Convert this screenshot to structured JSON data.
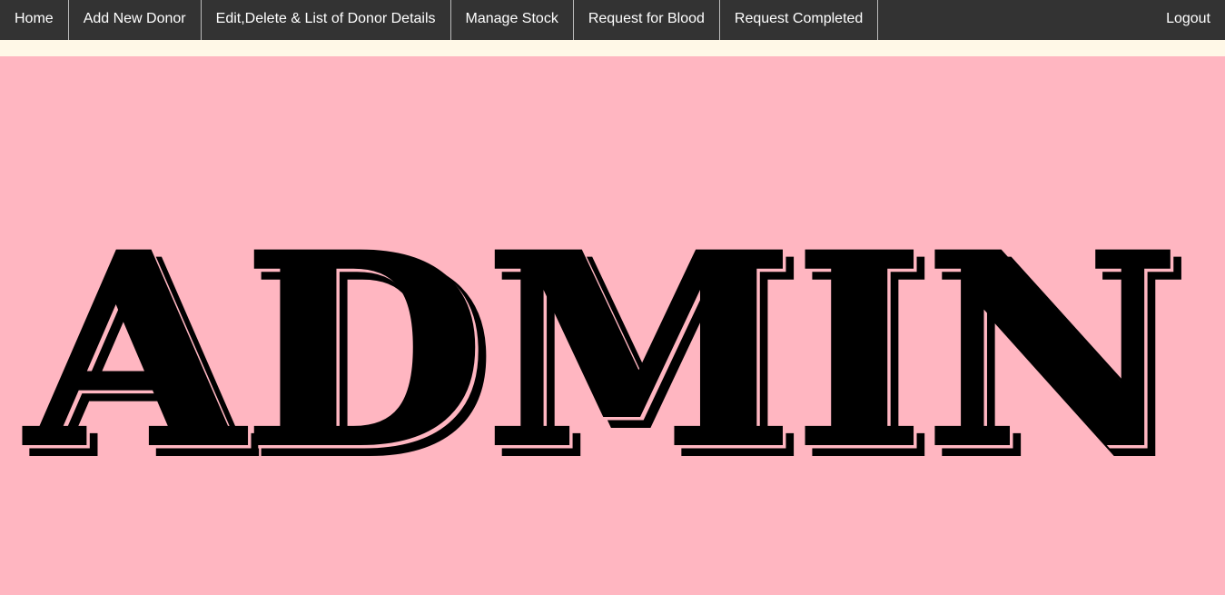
{
  "nav": {
    "items": [
      {
        "label": "Home"
      },
      {
        "label": "Add New Donor"
      },
      {
        "label": "Edit,Delete & List of Donor Details"
      },
      {
        "label": "Manage Stock"
      },
      {
        "label": "Request for Blood"
      },
      {
        "label": "Request Completed"
      }
    ],
    "logout_label": "Logout"
  },
  "hero": {
    "title": "ADMIN"
  },
  "colors": {
    "navbar_bg": "#333333",
    "nav_text": "#ffffff",
    "strip_bg": "#fff8e7",
    "page_bg": "#ffb6c1",
    "title_color": "#000000"
  }
}
